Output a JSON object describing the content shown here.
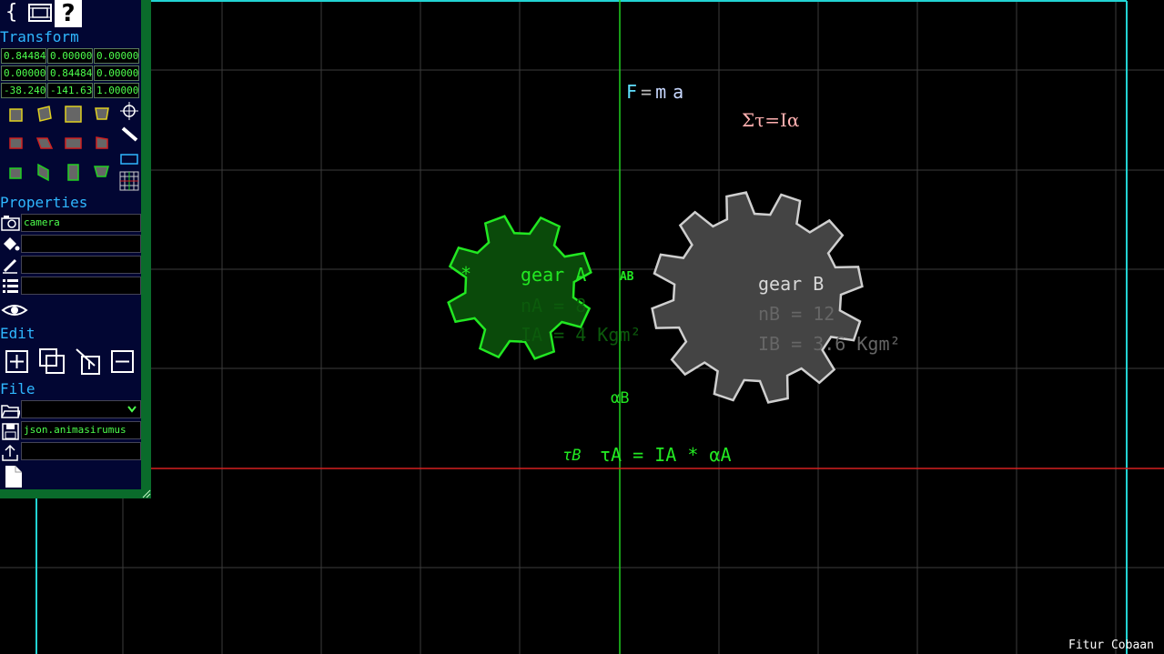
{
  "toolbar": {
    "brace_label": "{",
    "help_label": "?"
  },
  "panel": {
    "transform_title": "Transform",
    "matrix": [
      [
        "0.84484",
        "0.00000",
        "0.00000"
      ],
      [
        "0.00000",
        "0.84484",
        "0.00000"
      ],
      [
        "-38.240",
        "-141.63",
        "1.00000"
      ]
    ],
    "properties_title": "Properties",
    "name_value": "camera",
    "fill_value": "",
    "stroke_value": "",
    "list_value": "",
    "edit_title": "Edit",
    "file_title": "File",
    "file_select_value": "",
    "save_value": "json.animasirumus",
    "upload_value": ""
  },
  "canvas": {
    "formula_f_letter": "F",
    "formula_eq": "=",
    "formula_m": "m",
    "formula_a": "a",
    "formula_torque": "Στ=Iα",
    "gearA": {
      "star": "*",
      "name": "gear A",
      "n_text": "nA = 8",
      "i_text": "IA = 4 Kgm²"
    },
    "gearB": {
      "name": "gear B",
      "n_text": "nB = 12",
      "i_text": "IB = 3.6 Kgm²"
    },
    "alpha_label": "αB",
    "tau_b_label": "τB",
    "tau_equation": "τA = IA * αA",
    "center_marker": "A B"
  },
  "status": {
    "mode_label": "Fitur Cobaan"
  },
  "colors": {
    "grid": "#3c3c3c",
    "frame": "#22d3d3",
    "axis_y": "#20d020",
    "axis_x": "#d42020",
    "gearA_fill": "#0a4a0a",
    "gearA_stroke": "#22e822",
    "gearB_fill": "#444444",
    "gearB_stroke": "#cfcfcf",
    "panel_bg": "#020633",
    "panel_border": "#0a6b2b",
    "section_title": "#2fb7ff",
    "value_text": "#4dff4d"
  }
}
